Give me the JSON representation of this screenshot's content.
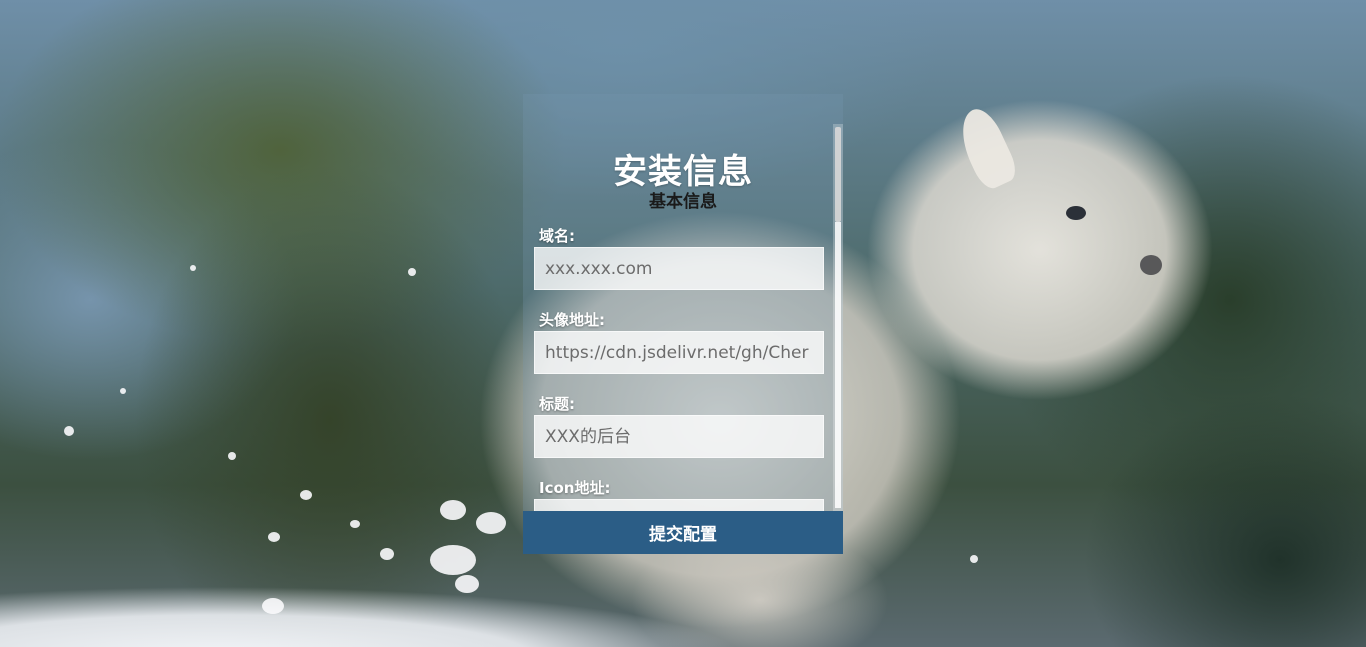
{
  "panel": {
    "title": "安装信息",
    "subtitle": "基本信息",
    "fields": [
      {
        "label": "域名:",
        "placeholder": "xxx.xxx.com",
        "value": ""
      },
      {
        "label": "头像地址:",
        "placeholder": "https://cdn.jsdelivr.net/gh/Cher",
        "value": ""
      },
      {
        "label": "标题:",
        "placeholder": "XXX的后台",
        "value": ""
      },
      {
        "label": "Icon地址:",
        "placeholder": "",
        "value": ""
      }
    ],
    "submit_label": "提交配置"
  },
  "colors": {
    "submit_bg": "#2b5d86",
    "title_text": "#ffffff",
    "subtitle_text": "#1a1a1a"
  },
  "background": {
    "subject": "white mountain goat kid running through snow, blurred forest"
  }
}
